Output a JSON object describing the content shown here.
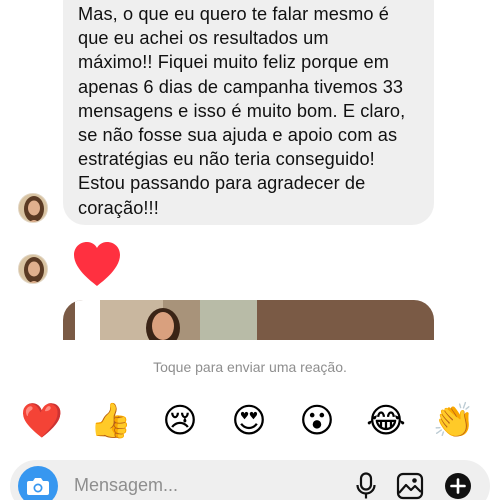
{
  "message": {
    "lines": [
      "Mas, o que eu quero te falar mesmo é",
      "que eu achei os resultados um",
      "máximo!! Fiquei muito feliz porque em",
      "apenas 6 dias de campanha tivemos 33",
      "mensagens e isso é muito bom. E claro,",
      "se não fosse sua ajuda e apoio com as",
      "estratégias eu não teria conseguido!",
      "Estou passando para agradecer de",
      "coração!!!"
    ]
  },
  "reaction_hint": "Toque para enviar uma reação.",
  "reactions": [
    {
      "emoji": "❤️",
      "icon": "red-heart-emoji"
    },
    {
      "emoji": "👍",
      "icon": "thumbs-up-emoji"
    },
    {
      "emoji": "😢",
      "icon": "crying-face-emoji"
    },
    {
      "emoji": "😍",
      "icon": "heart-eyes-emoji"
    },
    {
      "emoji": "😮",
      "icon": "surprised-face-emoji"
    },
    {
      "emoji": "😂",
      "icon": "tears-of-joy-emoji"
    },
    {
      "emoji": "👏",
      "icon": "clapping-hands-emoji"
    }
  ],
  "composer": {
    "placeholder": "Mensagem...",
    "icons": [
      "camera-icon",
      "microphone-icon",
      "gallery-icon",
      "plus-icon"
    ]
  },
  "colors": {
    "bubble_bg": "#efefef",
    "accent_blue": "#3797f0",
    "heart_red": "#ff3040",
    "hint_gray": "#8e8e8e"
  }
}
